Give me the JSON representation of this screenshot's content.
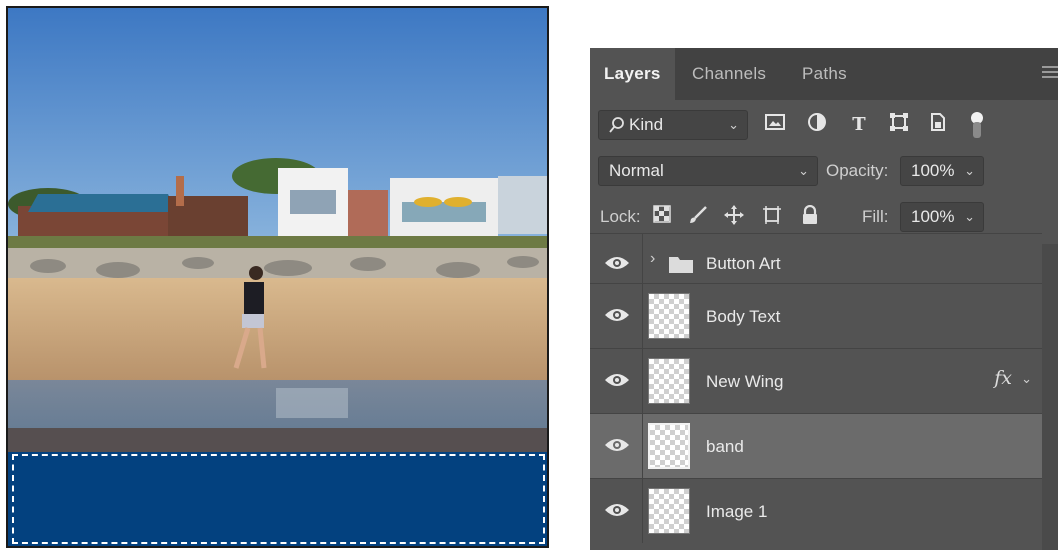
{
  "panel": {
    "tabs": [
      {
        "label": "Layers",
        "active": true
      },
      {
        "label": "Channels",
        "active": false
      },
      {
        "label": "Paths",
        "active": false
      }
    ],
    "filter": {
      "label": "Kind",
      "icons": [
        "image-filter-icon",
        "adjustment-filter-icon",
        "type-filter-icon",
        "shape-filter-icon",
        "smart-object-filter-icon",
        "filter-toggle-icon"
      ]
    },
    "blend_mode": "Normal",
    "opacity": {
      "label": "Opacity:",
      "value": "100%"
    },
    "lock": {
      "label": "Lock:",
      "icons": [
        "lock-transparent-icon",
        "lock-paint-icon",
        "lock-position-icon",
        "lock-artboard-icon",
        "lock-all-icon"
      ]
    },
    "fill": {
      "label": "Fill:",
      "value": "100%"
    },
    "layers": [
      {
        "name": "Button Art",
        "type": "group",
        "visible": true,
        "selected": false
      },
      {
        "name": "Body Text",
        "type": "layer",
        "visible": true,
        "selected": false
      },
      {
        "name": "New Wing",
        "type": "layer",
        "visible": true,
        "selected": false,
        "fx": "fx"
      },
      {
        "name": "band",
        "type": "layer",
        "visible": true,
        "selected": true
      },
      {
        "name": "Image 1",
        "type": "layer",
        "visible": true,
        "selected": false
      }
    ]
  },
  "canvas": {
    "band_color": "#03417f",
    "selection": "marquee"
  },
  "colors": {
    "panel_bg": "#535353",
    "tab_bar": "#424242",
    "selected_row": "#6b6b6b"
  }
}
